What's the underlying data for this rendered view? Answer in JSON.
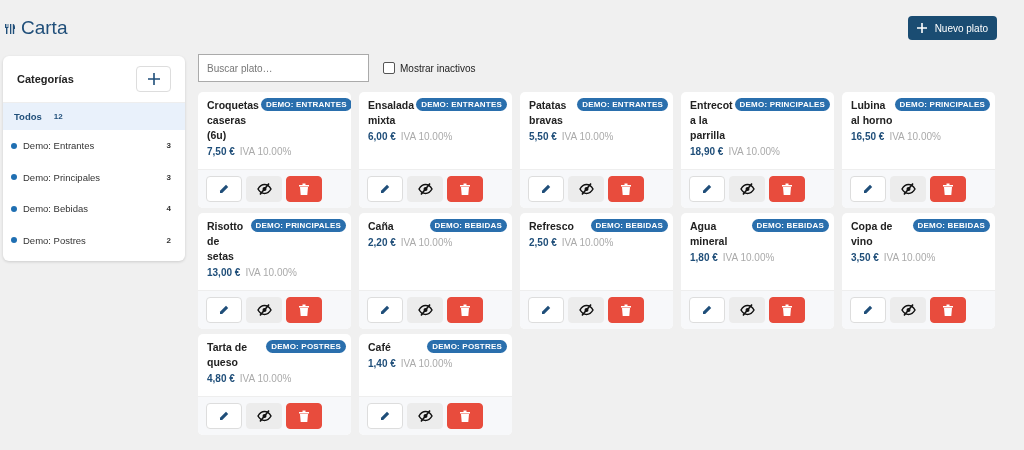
{
  "header": {
    "title": "Carta",
    "new_button": "Nuevo plato"
  },
  "sidebar": {
    "title": "Categorías",
    "items": [
      {
        "label": "Todos",
        "count": "12",
        "selected": true,
        "kind": "all"
      },
      {
        "label": "Demo: Entrantes",
        "count": "3",
        "selected": false,
        "kind": "category"
      },
      {
        "label": "Demo: Principales",
        "count": "3",
        "selected": false,
        "kind": "category"
      },
      {
        "label": "Demo: Bebidas",
        "count": "4",
        "selected": false,
        "kind": "category"
      },
      {
        "label": "Demo: Postres",
        "count": "2",
        "selected": false,
        "kind": "category"
      }
    ]
  },
  "search": {
    "placeholder": "Buscar plato…"
  },
  "show_inactive": {
    "label": "Mostrar inactivos",
    "checked": false
  },
  "dishes": [
    {
      "name": "Croquetas caseras (6u)",
      "category": "DEMO: ENTRANTES",
      "price": "7,50 €",
      "tax": "IVA 10.00%"
    },
    {
      "name": "Ensalada mixta",
      "category": "DEMO: ENTRANTES",
      "price": "6,00 €",
      "tax": "IVA 10.00%"
    },
    {
      "name": "Patatas bravas",
      "category": "DEMO: ENTRANTES",
      "price": "5,50 €",
      "tax": "IVA 10.00%"
    },
    {
      "name": "Entrecot a la parrilla",
      "category": "DEMO: PRINCIPALES",
      "price": "18,90 €",
      "tax": "IVA 10.00%"
    },
    {
      "name": "Lubina al horno",
      "category": "DEMO: PRINCIPALES",
      "price": "16,50 €",
      "tax": "IVA 10.00%"
    },
    {
      "name": "Risotto de setas",
      "category": "DEMO: PRINCIPALES",
      "price": "13,00 €",
      "tax": "IVA 10.00%"
    },
    {
      "name": "Caña",
      "category": "DEMO: BEBIDAS",
      "price": "2,20 €",
      "tax": "IVA 10.00%"
    },
    {
      "name": "Refresco",
      "category": "DEMO: BEBIDAS",
      "price": "2,50 €",
      "tax": "IVA 10.00%"
    },
    {
      "name": "Agua mineral",
      "category": "DEMO: BEBIDAS",
      "price": "1,80 €",
      "tax": "IVA 10.00%"
    },
    {
      "name": "Copa de vino",
      "category": "DEMO: BEBIDAS",
      "price": "3,50 €",
      "tax": "IVA 10.00%"
    },
    {
      "name": "Tarta de queso",
      "category": "DEMO: POSTRES",
      "price": "4,80 €",
      "tax": "IVA 10.00%"
    },
    {
      "name": "Café",
      "category": "DEMO: POSTRES",
      "price": "1,40 €",
      "tax": "IVA 10.00%"
    }
  ]
}
